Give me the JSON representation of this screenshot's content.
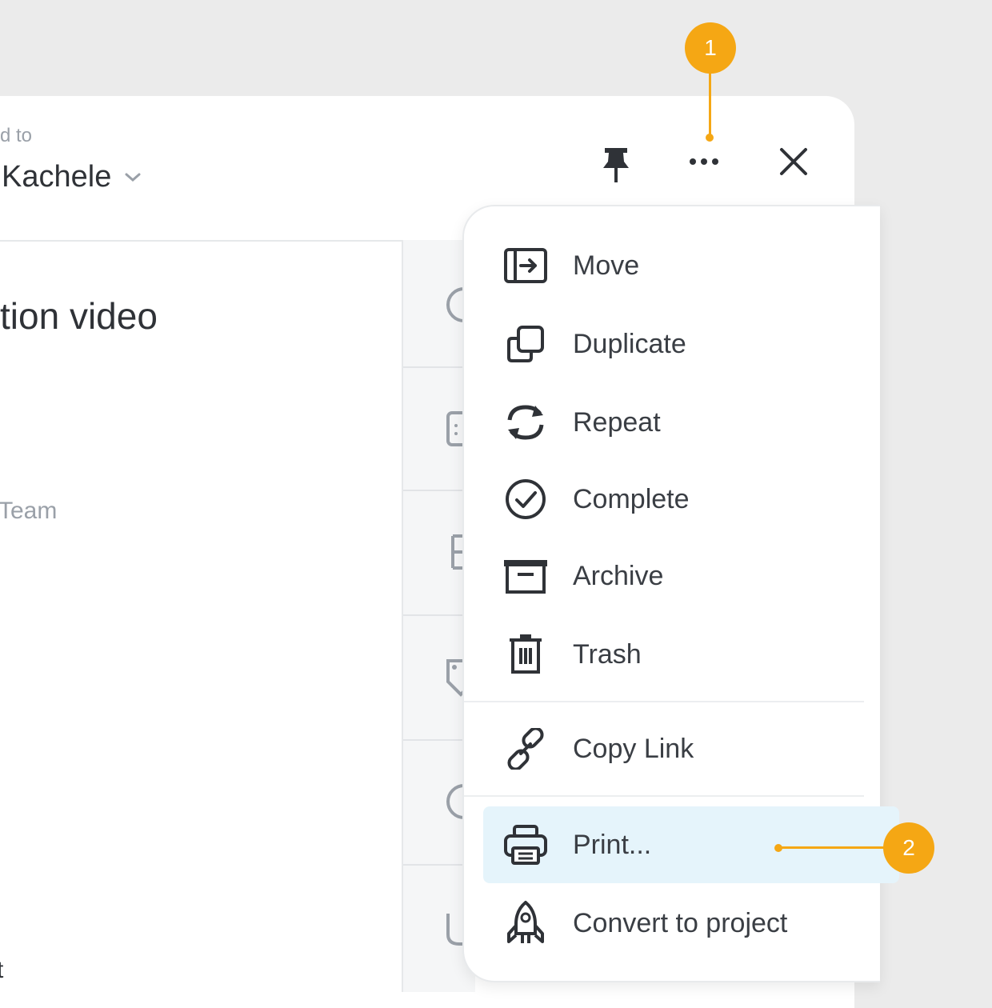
{
  "header": {
    "assigned_label": "d to",
    "assignee_name": "Kachele",
    "pin_icon": "pin-icon",
    "more_icon": "more-horizontal-icon",
    "close_icon": "close-icon"
  },
  "task": {
    "title": "tion video",
    "team_label": "Team",
    "bottom_text": "t"
  },
  "menu": {
    "items": [
      {
        "label": "Move",
        "icon": "move-icon"
      },
      {
        "label": "Duplicate",
        "icon": "duplicate-icon"
      },
      {
        "label": "Repeat",
        "icon": "repeat-icon"
      },
      {
        "label": "Complete",
        "icon": "check-circle-icon"
      },
      {
        "label": "Archive",
        "icon": "archive-icon"
      },
      {
        "label": "Trash",
        "icon": "trash-icon"
      },
      {
        "label": "Copy Link",
        "icon": "link-icon"
      },
      {
        "label": "Print...",
        "icon": "printer-icon"
      },
      {
        "label": "Convert to project",
        "icon": "rocket-icon"
      }
    ],
    "highlighted": "Print..."
  },
  "callouts": [
    "1",
    "2"
  ],
  "colors": {
    "accent": "#f5a714",
    "highlight": "#e5f4fb",
    "text": "#3a3e44"
  }
}
